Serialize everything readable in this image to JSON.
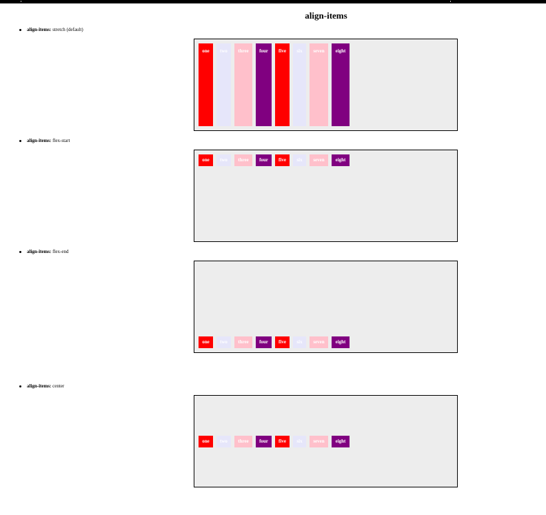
{
  "page": {
    "title": "align-items"
  },
  "sections": [
    {
      "prop": "align-items:",
      "value": "stretch (default)"
    },
    {
      "prop": "align-items:",
      "value": "flex-start"
    },
    {
      "prop": "align-items:",
      "value": "flex-end"
    },
    {
      "prop": "align-items:",
      "value": "center"
    }
  ],
  "items": [
    "one",
    "two",
    "three",
    "four",
    "five",
    "six",
    "seven",
    "eight"
  ],
  "colors": {
    "red": "#ff0000",
    "lavender": "#e6e6fa",
    "pink": "#ffc0cb",
    "purple": "#800080",
    "container": "#ededed"
  }
}
